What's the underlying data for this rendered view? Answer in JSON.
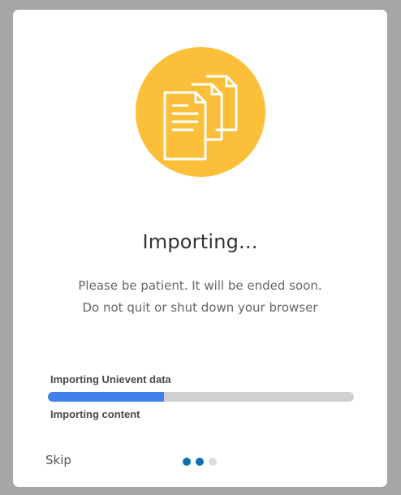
{
  "dialog": {
    "title": "Importing...",
    "description_line1": "Please be patient. It will be ended soon.",
    "description_line2": "Do not quit or shut down your browser",
    "icon": "documents-icon",
    "accent_color": "#fbbf3a"
  },
  "progress": {
    "primary_label": "Importing Unievent data",
    "fraction": 0.38,
    "fill_color": "#4181ea",
    "track_color": "#d0d0d0",
    "secondary_label": "Importing content"
  },
  "footer": {
    "skip_label": "Skip",
    "steps": [
      {
        "state": "active",
        "color": "#0b6fb3"
      },
      {
        "state": "active",
        "color": "#0b6fb3"
      },
      {
        "state": "inactive",
        "color": "#dcdcdc"
      }
    ]
  }
}
